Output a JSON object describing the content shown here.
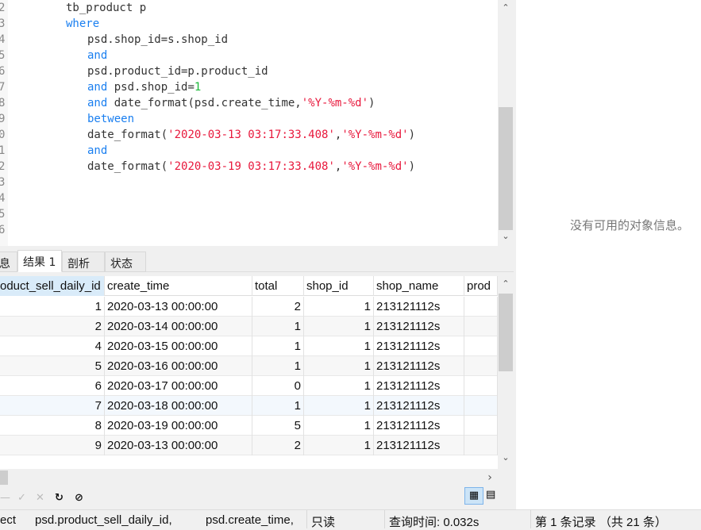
{
  "editor": {
    "line_numbers": [
      "2",
      "3",
      "4",
      "5",
      "6",
      "7",
      "8",
      "9",
      "0",
      "1",
      "2",
      "3",
      "4",
      "5",
      "6"
    ],
    "lines": [
      [
        {
          "t": "tb_product p",
          "c": ""
        }
      ],
      [
        {
          "t": "where",
          "c": "kw"
        }
      ],
      [
        {
          "t": "psd.shop_id=s.shop_id",
          "c": ""
        }
      ],
      [
        {
          "t": "and",
          "c": "kw"
        }
      ],
      [
        {
          "t": "psd.product_id=p.product_id",
          "c": ""
        }
      ],
      [
        {
          "t": "and",
          "c": "kw"
        },
        {
          "t": " psd.shop_id=",
          "c": ""
        },
        {
          "t": "1",
          "c": "num"
        }
      ],
      [
        {
          "t": "and",
          "c": "kw"
        },
        {
          "t": " date_format(psd.create_time,",
          "c": ""
        },
        {
          "t": "'%Y-%m-%d'",
          "c": "str"
        },
        {
          "t": ")",
          "c": ""
        }
      ],
      [
        {
          "t": "between",
          "c": "kw"
        }
      ],
      [
        {
          "t": "date_format(",
          "c": ""
        },
        {
          "t": "'2020-03-13 03:17:33.408'",
          "c": "str"
        },
        {
          "t": ",",
          "c": ""
        },
        {
          "t": "'%Y-%m-%d'",
          "c": "str"
        },
        {
          "t": ")",
          "c": ""
        }
      ],
      [
        {
          "t": "and",
          "c": "kw"
        }
      ],
      [
        {
          "t": "date_format(",
          "c": ""
        },
        {
          "t": "'2020-03-19 03:17:33.408'",
          "c": "str"
        },
        {
          "t": ",",
          "c": ""
        },
        {
          "t": "'%Y-%m-%d'",
          "c": "str"
        },
        {
          "t": ")",
          "c": ""
        }
      ]
    ],
    "indents": [
      1,
      1,
      2,
      2,
      2,
      2,
      2,
      2,
      2,
      2,
      2
    ]
  },
  "right_panel": {
    "empty_text": "没有可用的对象信息。"
  },
  "tabs": [
    {
      "label": "息"
    },
    {
      "label": "结果 1",
      "active": true
    },
    {
      "label": "剖析"
    },
    {
      "label": "状态"
    }
  ],
  "grid": {
    "columns": [
      "oduct_sell_daily_id",
      "create_time",
      "total",
      "shop_id",
      "shop_name",
      "prod"
    ],
    "rows": [
      [
        "1",
        "2020-03-13 00:00:00",
        "2",
        "1",
        "213121112s",
        ""
      ],
      [
        "2",
        "2020-03-14 00:00:00",
        "1",
        "1",
        "213121112s",
        ""
      ],
      [
        "4",
        "2020-03-15 00:00:00",
        "1",
        "1",
        "213121112s",
        ""
      ],
      [
        "5",
        "2020-03-16 00:00:00",
        "1",
        "1",
        "213121112s",
        ""
      ],
      [
        "6",
        "2020-03-17 00:00:00",
        "0",
        "1",
        "213121112s",
        ""
      ],
      [
        "7",
        "2020-03-18 00:00:00",
        "1",
        "1",
        "213121112s",
        ""
      ],
      [
        "8",
        "2020-03-19 00:00:00",
        "5",
        "1",
        "213121112s",
        ""
      ],
      [
        "9",
        "2020-03-13 00:00:00",
        "2",
        "1",
        "213121112s",
        ""
      ]
    ]
  },
  "status": {
    "sql_prefix": "ect",
    "sql_col1": "psd.product_sell_daily_id,",
    "sql_col2": "psd.create_time,",
    "mode": "只读",
    "query_time": "查询时间: 0.032s",
    "record": "第 1 条记录 （共 21 条）"
  },
  "toolbar_icons": [
    "minus-icon",
    "check-icon",
    "cross-icon",
    "refresh-icon",
    "stop-icon",
    "grid-view-icon",
    "form-view-icon"
  ]
}
